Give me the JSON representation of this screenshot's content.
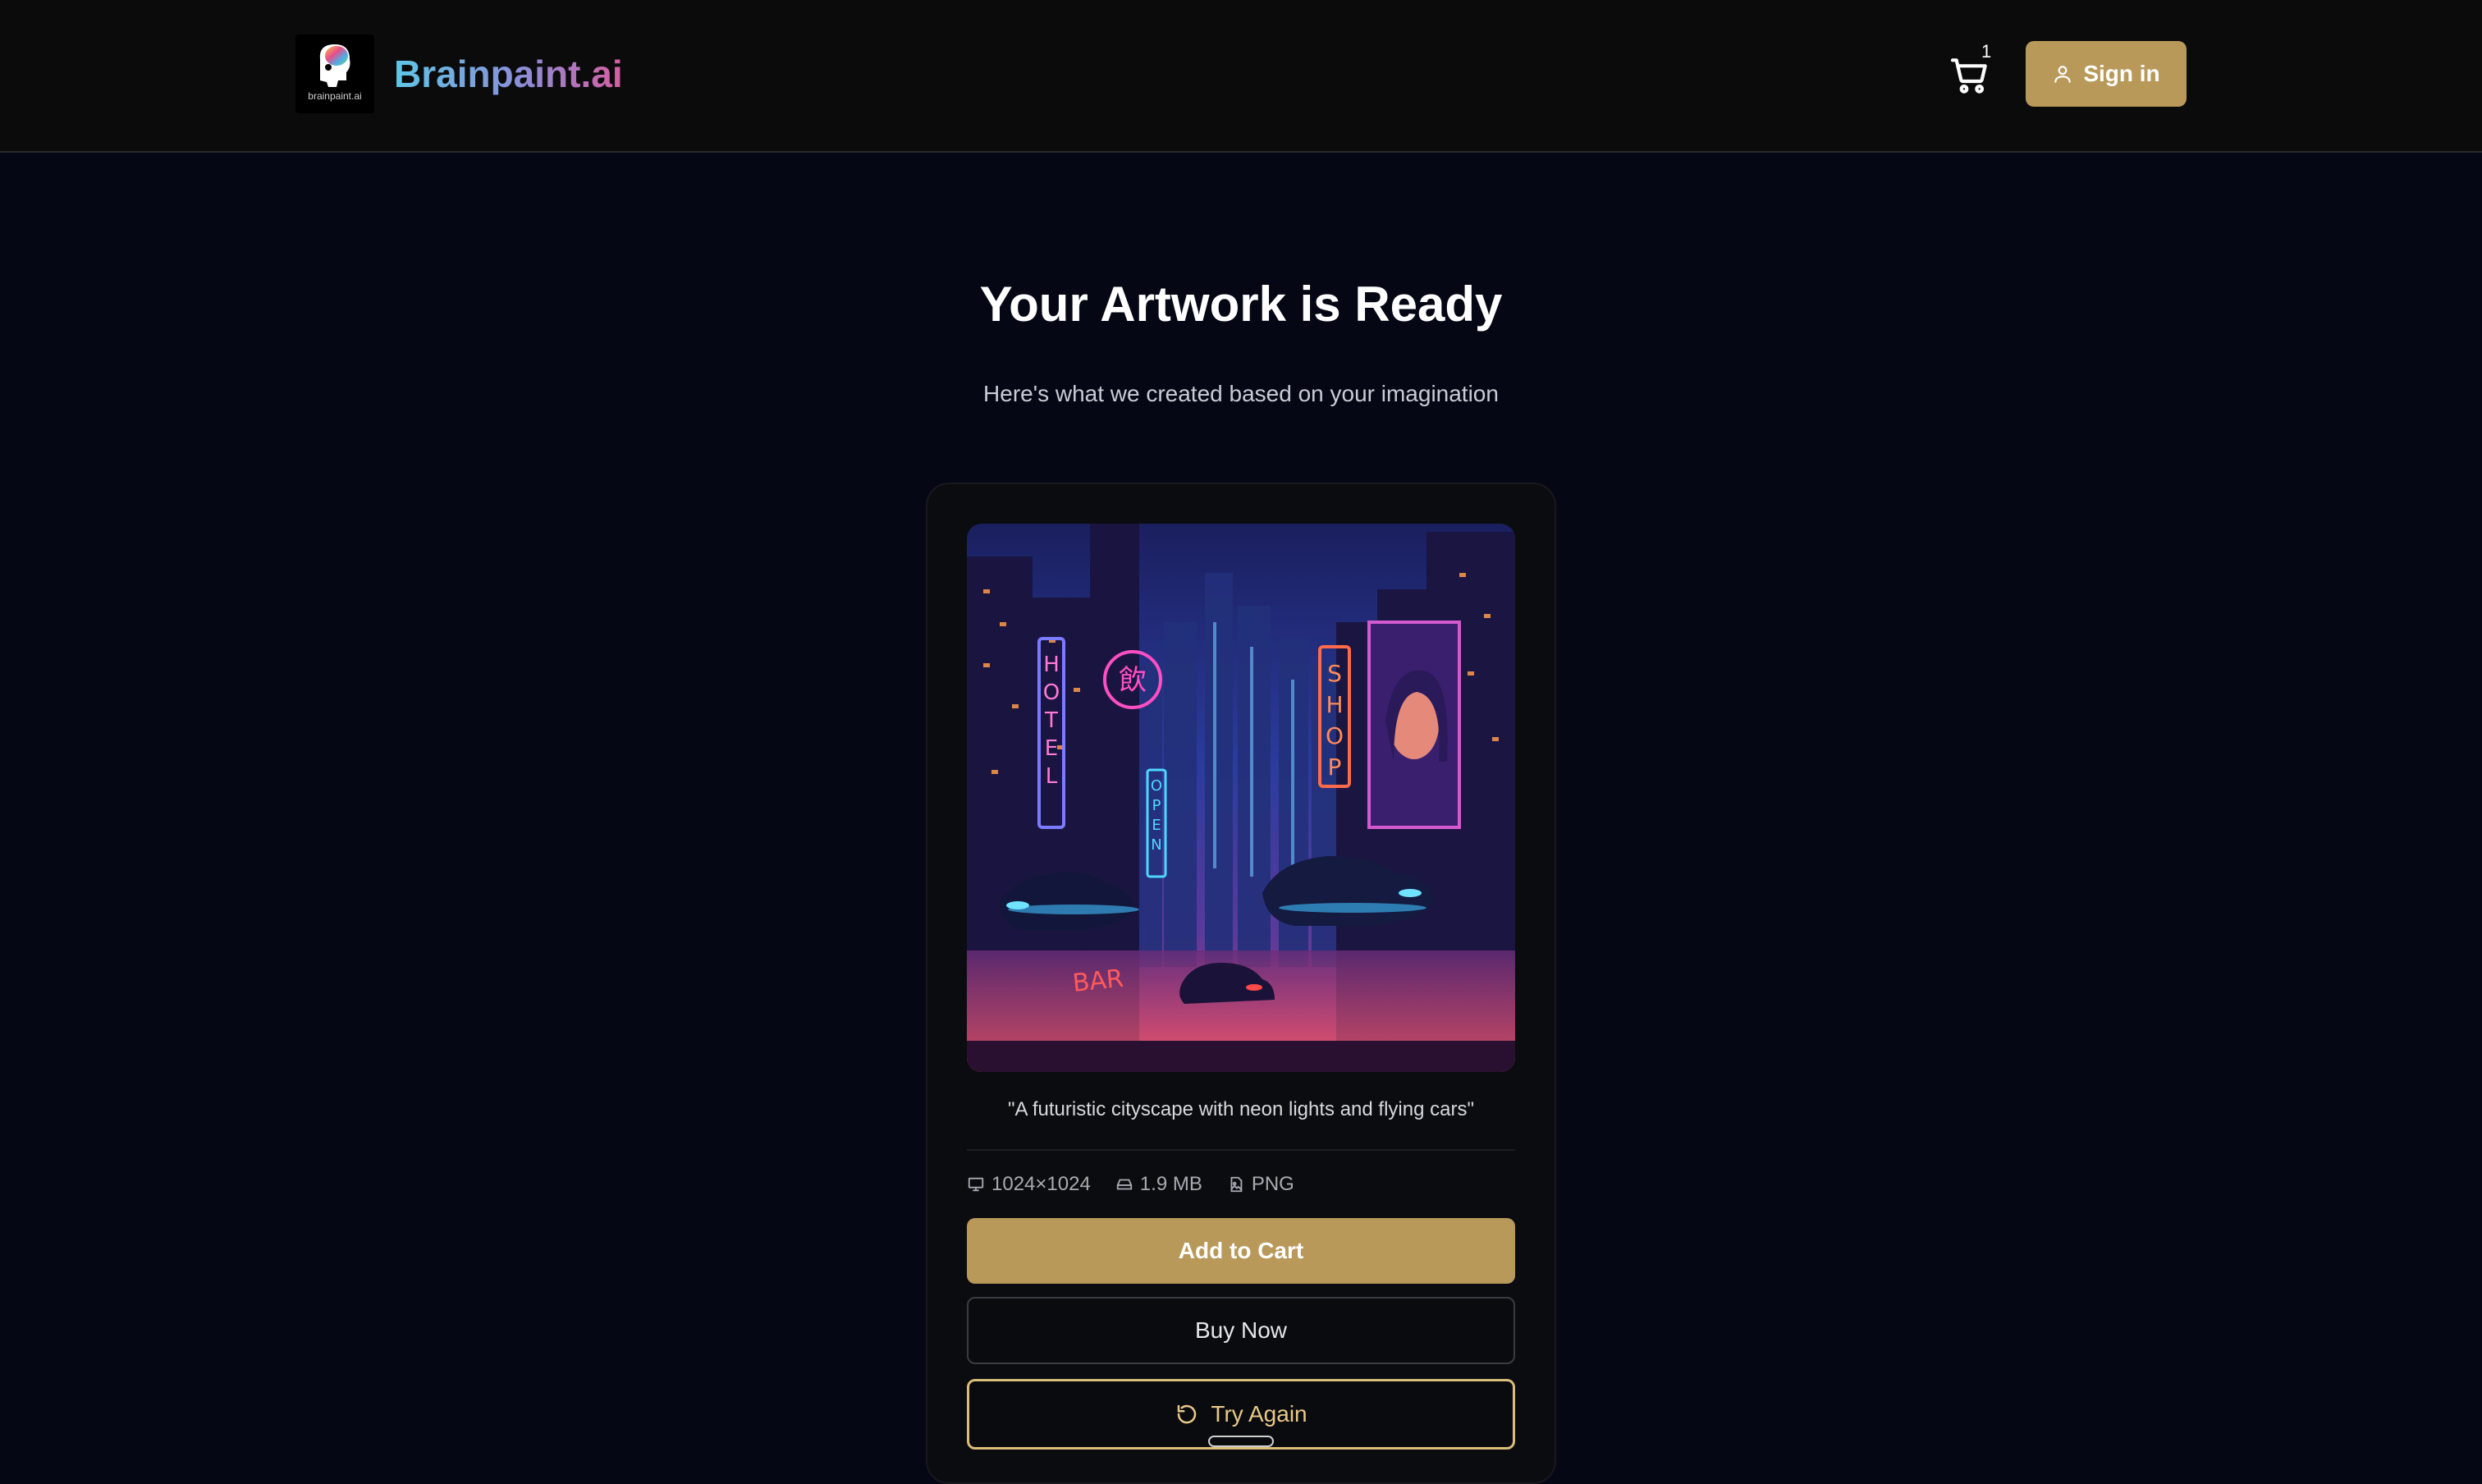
{
  "header": {
    "logo_text": "brainpaint.ai",
    "brand": "Brainpaint.ai",
    "cart_count": "1",
    "signin_label": "Sign in"
  },
  "main": {
    "title": "Your Artwork is Ready",
    "subtitle": "Here's what we created based on your imagination",
    "prompt": "\"A futuristic cityscape with neon lights and flying cars\"",
    "artwork_signs": {
      "hotel": "HOTEL",
      "shop": "SHOP",
      "open": "OPEN",
      "bar": "BAR",
      "kanji": "飲"
    },
    "meta": {
      "dimensions": "1024×1024",
      "size": "1.9 MB",
      "format": "PNG"
    },
    "buttons": {
      "add_to_cart": "Add to Cart",
      "buy_now": "Buy Now",
      "try_again": "Try Again"
    }
  },
  "colors": {
    "accent": "#b8995a",
    "accent_outline": "#d9bd78",
    "background": "#050814",
    "header": "#0b0b0c"
  },
  "icons": [
    "logo-brain-icon",
    "cart-icon",
    "user-icon",
    "monitor-icon",
    "hard-drive-icon",
    "image-file-icon",
    "refresh-icon"
  ]
}
